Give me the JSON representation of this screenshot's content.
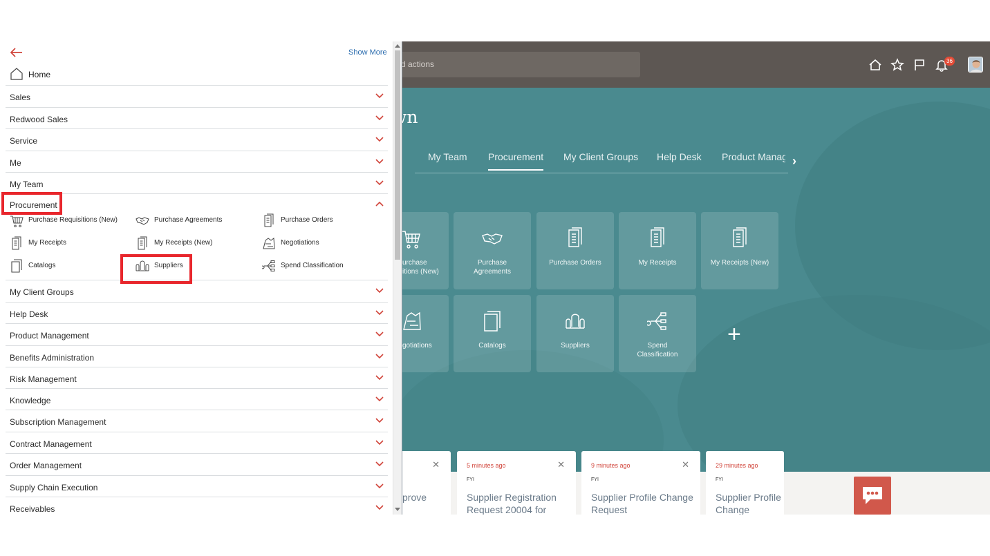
{
  "header": {
    "search_placeholder": "d actions",
    "notification_count": "36"
  },
  "hero": {
    "greeting": "rown",
    "tabs": [
      "My Team",
      "Procurement",
      "My Client Groups",
      "Help Desk",
      "Product Manage"
    ],
    "active_tab": "Procurement"
  },
  "tiles": [
    {
      "label": "urchase\nitions (New)",
      "icon": "cart-icon"
    },
    {
      "label": "Purchase\nAgreements",
      "icon": "handshake-icon"
    },
    {
      "label": "Purchase Orders",
      "icon": "document-icon"
    },
    {
      "label": "My Receipts",
      "icon": "document-icon"
    },
    {
      "label": "My Receipts (New)",
      "icon": "document-icon"
    },
    {
      "label": "gotiations",
      "icon": "negotiation-icon"
    },
    {
      "label": "Catalogs",
      "icon": "catalog-icon"
    },
    {
      "label": "Suppliers",
      "icon": "suppliers-icon"
    },
    {
      "label": "Spend\nClassification",
      "icon": "spend-classification-icon"
    }
  ],
  "add_tile": "+",
  "cards": [
    {
      "time": "",
      "fyi": "",
      "title": "prove"
    },
    {
      "time": "5 minutes ago",
      "fyi": "FYI",
      "title": "Supplier Registration Request 20004 for"
    },
    {
      "time": "9 minutes ago",
      "fyi": "FYI",
      "title": "Supplier Profile Change Request"
    },
    {
      "time": "29 minutes ago",
      "fyi": "FYI",
      "title": "Supplier Profile Change Reques"
    }
  ],
  "drawer": {
    "show_more": "Show More",
    "home": "Home",
    "groups_top": [
      "Sales",
      "Redwood Sales",
      "Service",
      "Me",
      "My Team"
    ],
    "expanded_group": "Procurement",
    "procurement_items": [
      {
        "label": "Purchase Requisitions (New)",
        "icon": "cart-icon"
      },
      {
        "label": "Purchase Agreements",
        "icon": "handshake-icon"
      },
      {
        "label": "Purchase Orders",
        "icon": "document-icon"
      },
      {
        "label": "My Receipts",
        "icon": "document-icon"
      },
      {
        "label": "My Receipts (New)",
        "icon": "document-icon"
      },
      {
        "label": "Negotiations",
        "icon": "negotiation-icon"
      },
      {
        "label": "Catalogs",
        "icon": "catalog-icon"
      },
      {
        "label": "Suppliers",
        "icon": "suppliers-icon"
      },
      {
        "label": "Spend Classification",
        "icon": "spend-classification-icon"
      }
    ],
    "groups_bottom": [
      "My Client Groups",
      "Help Desk",
      "Product Management",
      "Benefits Administration",
      "Risk Management",
      "Knowledge",
      "Subscription Management",
      "Contract Management",
      "Order Management",
      "Supply Chain Execution",
      "Receivables"
    ]
  },
  "colors": {
    "accent_red": "#d1453b",
    "highlight_red": "#e8262c",
    "link_blue": "#2b6cae",
    "hero_teal": "#4a8a8f",
    "header_gray": "#5d5753"
  }
}
